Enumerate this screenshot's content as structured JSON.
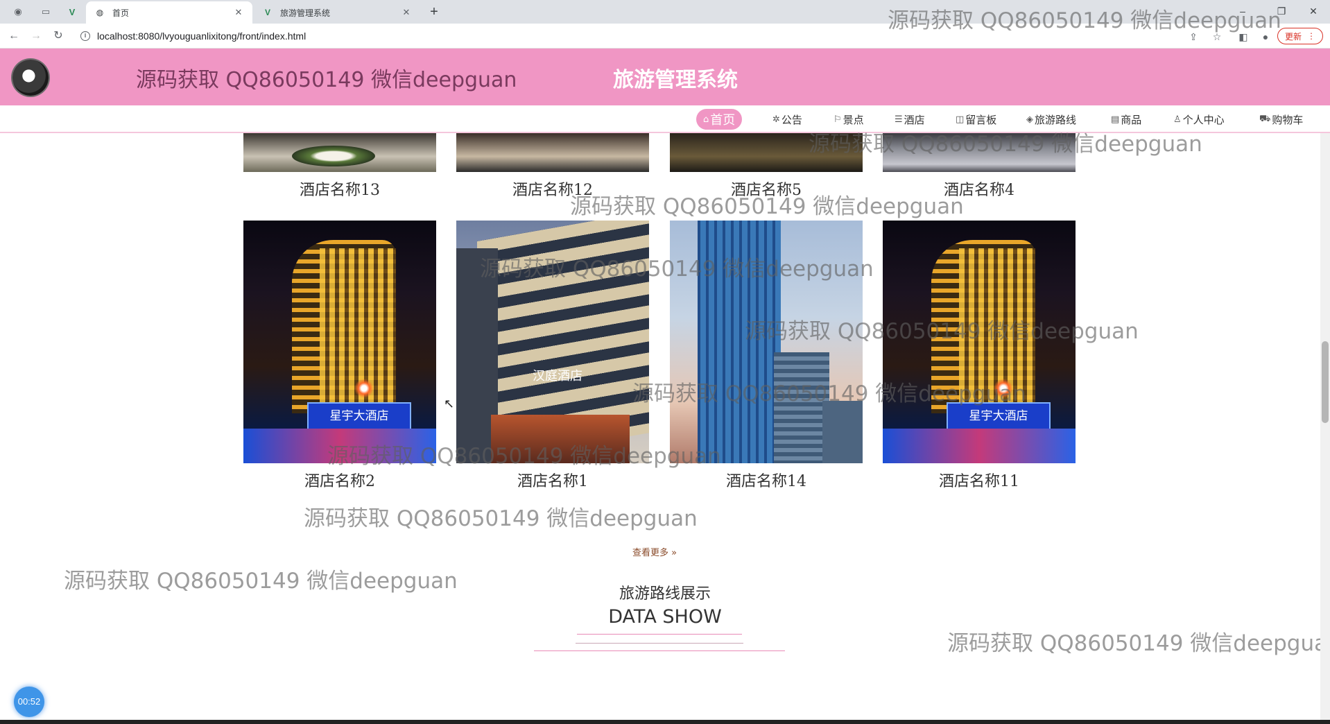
{
  "browser": {
    "tabs": [
      {
        "title": "首页",
        "active": true
      },
      {
        "title": "旅游管理系统",
        "active": false
      }
    ],
    "url": "localhost:8080/lvyouguanlixitong/front/index.html",
    "update_label": "更新"
  },
  "header": {
    "watermark": "源码获取 QQ86050149 微信deepguan",
    "title": "旅游管理系统"
  },
  "nav": {
    "items": [
      {
        "icon": "⌂",
        "label": "首页"
      },
      {
        "icon": "✲",
        "label": "公告"
      },
      {
        "icon": "⚐",
        "label": "景点"
      },
      {
        "icon": "☰",
        "label": "酒店"
      },
      {
        "icon": "◫",
        "label": "留言板"
      },
      {
        "icon": "◈",
        "label": "旅游路线"
      },
      {
        "icon": "▤",
        "label": "商品"
      },
      {
        "icon": "♙",
        "label": "个人中心"
      },
      {
        "icon": "⛟",
        "label": "购物车"
      }
    ]
  },
  "hotels_top": [
    {
      "name": "酒店名称13"
    },
    {
      "name": "酒店名称12"
    },
    {
      "name": "酒店名称5"
    },
    {
      "name": "酒店名称4"
    }
  ],
  "hotels": [
    {
      "name": "酒店名称2",
      "sign": "星宇大酒店"
    },
    {
      "name": "酒店名称1",
      "sign": "汉庭酒店"
    },
    {
      "name": "酒店名称14"
    },
    {
      "name": "酒店名称11",
      "sign": "星宇大酒店"
    }
  ],
  "more_label": "查看更多 »",
  "section": {
    "title": "旅游路线展示",
    "subtitle": "DATA SHOW"
  },
  "watermark_text": "源码获取 QQ86050149 微信deepguan",
  "timer": "00:52"
}
